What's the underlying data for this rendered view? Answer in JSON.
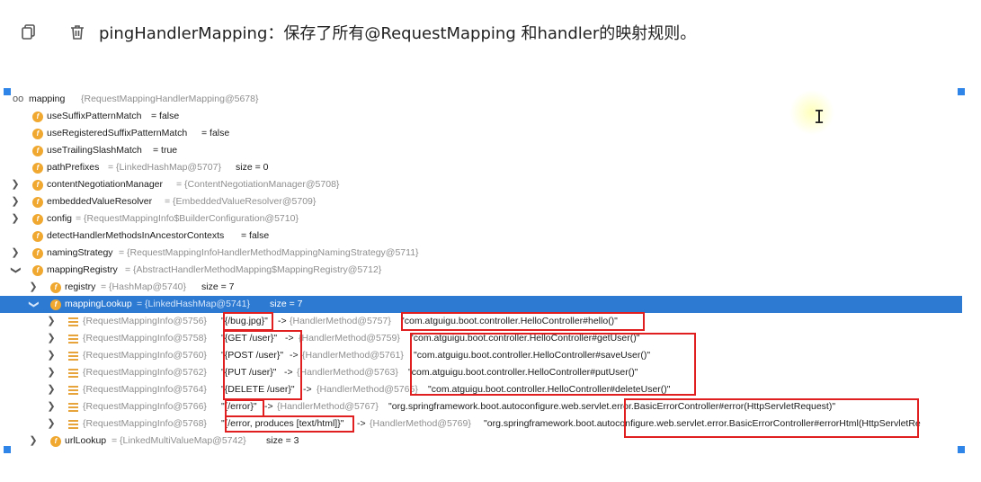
{
  "toolbar": {
    "copy_icon": "copy-icon",
    "delete_icon": "trash-icon"
  },
  "heading": "pingHandlerMapping：保存了所有@RequestMapping 和handler的映射规则。",
  "tree": {
    "root": {
      "name": "mapping",
      "value": "{RequestMappingHandlerMapping@5678}"
    },
    "fields": [
      {
        "name": "useSuffixPatternMatch",
        "value": "= false"
      },
      {
        "name": "useRegisteredSuffixPatternMatch",
        "value": "= false"
      },
      {
        "name": "useTrailingSlashMatch",
        "value": "= true"
      },
      {
        "name": "pathPrefixes",
        "value": "= {LinkedHashMap@5707}",
        "extra": "size = 0"
      },
      {
        "name": "contentNegotiationManager",
        "value": "= {ContentNegotiationManager@5708}"
      },
      {
        "name": "embeddedValueResolver",
        "value": "= {EmbeddedValueResolver@5709}"
      },
      {
        "name": "config",
        "value": "= {RequestMappingInfo$BuilderConfiguration@5710}"
      },
      {
        "name": "detectHandlerMethodsInAncestorContexts",
        "value": "= false"
      },
      {
        "name": "namingStrategy",
        "value": "= {RequestMappingInfoHandlerMethodMappingNamingStrategy@5711}"
      },
      {
        "name": "mappingRegistry",
        "value": "= {AbstractHandlerMethodMapping$MappingRegistry@5712}"
      }
    ],
    "registry": {
      "name": "registry",
      "value": "= {HashMap@5740}",
      "extra": "size = 7"
    },
    "mappingLookup": {
      "name": "mappingLookup",
      "value": "= {LinkedHashMap@5741}",
      "extra": "size = 7"
    },
    "entries": [
      {
        "info": "{RequestMappingInfo@5756}",
        "key": "\"{/bug.jpg}\"",
        "arrow": "->",
        "method": "{HandlerMethod@5757}",
        "target": "\"com.atguigu.boot.controller.HelloController#hello()\""
      },
      {
        "info": "{RequestMappingInfo@5758}",
        "key": "\"{GET /user}\"",
        "arrow": "->",
        "method": "{HandlerMethod@5759}",
        "target": "\"com.atguigu.boot.controller.HelloController#getUser()\""
      },
      {
        "info": "{RequestMappingInfo@5760}",
        "key": "\"{POST /user}\"",
        "arrow": "->",
        "method": "{HandlerMethod@5761}",
        "target": "\"com.atguigu.boot.controller.HelloController#saveUser()\""
      },
      {
        "info": "{RequestMappingInfo@5762}",
        "key": "\"{PUT /user}\"",
        "arrow": "->",
        "method": "{HandlerMethod@5763}",
        "target": "\"com.atguigu.boot.controller.HelloController#putUser()\""
      },
      {
        "info": "{RequestMappingInfo@5764}",
        "key": "\"{DELETE /user}\"",
        "arrow": "->",
        "method": "{HandlerMethod@5765}",
        "target": "\"com.atguigu.boot.controller.HelloController#deleteUser()\""
      },
      {
        "info": "{RequestMappingInfo@5766}",
        "key": "\"{/error}\"",
        "arrow": "->",
        "method": "{HandlerMethod@5767}",
        "target": "\"org.springframework.boot.autoconfigure.web.servlet.error.BasicErrorController#error(HttpServletRequest)\""
      },
      {
        "info": "{RequestMappingInfo@5768}",
        "key": "\"{/error, produces [text/html]}\"",
        "arrow": "->",
        "method": "{HandlerMethod@5769}",
        "target": "\"org.springframework.boot.autoconfigure.web.servlet.error.BasicErrorController#errorHtml(HttpServletRe"
      }
    ],
    "urlLookup": {
      "name": "urlLookup",
      "value": "= {LinkedMultiValueMap@5742}",
      "extra": "size = 3"
    }
  }
}
